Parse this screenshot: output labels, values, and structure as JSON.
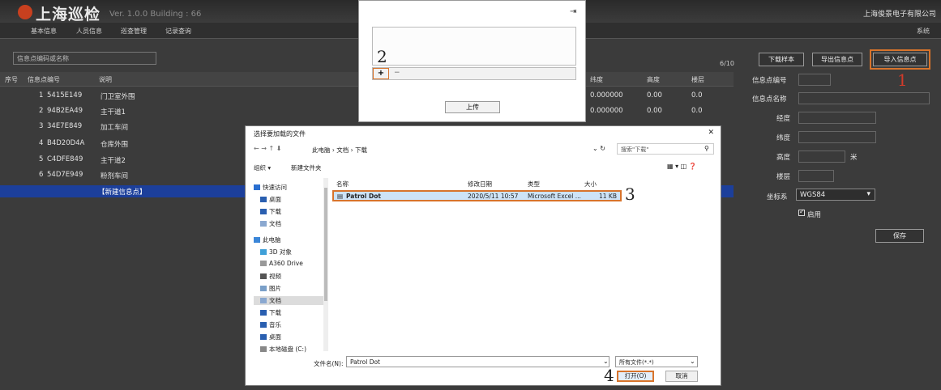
{
  "app": {
    "title": "上海巡检",
    "version": "Ver. 1.0.0 Building : 66",
    "company": "上海俊景电子有限公司"
  },
  "menu": {
    "items": [
      "基本信息",
      "人员信息",
      "巡查管理",
      "记录查询"
    ],
    "system": "系统"
  },
  "search": {
    "placeholder": "信息点编码或名称"
  },
  "table": {
    "count": "6/10",
    "headers": [
      "序号",
      "信息点编号",
      "说明",
      "纬度",
      "高度",
      "楼层"
    ],
    "rows": [
      {
        "no": "1",
        "code": "5415E149",
        "desc": "门卫室外围"
      },
      {
        "no": "2",
        "code": "94B2EA49",
        "desc": "主干道1"
      },
      {
        "no": "3",
        "code": "34E7E849",
        "desc": "加工车间"
      },
      {
        "no": "4",
        "code": "B4D20D4A",
        "desc": "仓库外围"
      },
      {
        "no": "5",
        "code": "C4DFE849",
        "desc": "主干道2"
      },
      {
        "no": "6",
        "code": "54D7E949",
        "desc": "粉剂车间"
      }
    ],
    "visible_values": [
      {
        "lat": "0.000000",
        "alt": "0.00",
        "floor": "0.0"
      },
      {
        "lat": "0.000000",
        "alt": "0.00",
        "floor": "0.0"
      }
    ],
    "new_row": "【新建信息点】"
  },
  "right_panel": {
    "buttons": {
      "download_sample": "下载样本",
      "export": "导出信息点",
      "import": "导入信息点"
    },
    "labels": {
      "code": "信息点编号",
      "name": "信息点名称",
      "lng": "经度",
      "lat": "纬度",
      "alt": "高度",
      "floor": "楼层",
      "coord": "坐标系"
    },
    "unit": "米",
    "coord_value": "WGS84",
    "enable_label": "启用",
    "save": "保存"
  },
  "upload": {
    "add": "+",
    "remove": "−",
    "upload_button": "上传"
  },
  "file_dialog": {
    "title": "选择要加载的文件",
    "path": [
      "此电脑",
      "文档",
      "下载"
    ],
    "search_placeholder": "搜索\"下载\"",
    "organize": "组织 ▾",
    "new_folder": "新建文件夹",
    "nav": [
      "快速访问",
      "桌面",
      "下载",
      "文档",
      "此电脑",
      "3D 对象",
      "A360 Drive",
      "视频",
      "图片",
      "文档",
      "下载",
      "音乐",
      "桌面",
      "本地磁盘 (C:)"
    ],
    "columns": [
      "名称",
      "修改日期",
      "类型",
      "大小"
    ],
    "file": {
      "name": "Patrol Dot",
      "date": "2020/5/11 10:57",
      "type": "Microsoft Excel ...",
      "size": "11 KB"
    },
    "filename_label": "文件名(N):",
    "filename_value": "Patrol Dot",
    "filter": "所有文件(*.*)",
    "open": "打开(O)",
    "cancel": "取消"
  },
  "annotations": {
    "1": "1",
    "2": "2",
    "3": "3",
    "4": "4"
  },
  "colors": {
    "highlight": "#d8742c",
    "selection": "#1c3f9b",
    "background": "#3b3b3b"
  }
}
